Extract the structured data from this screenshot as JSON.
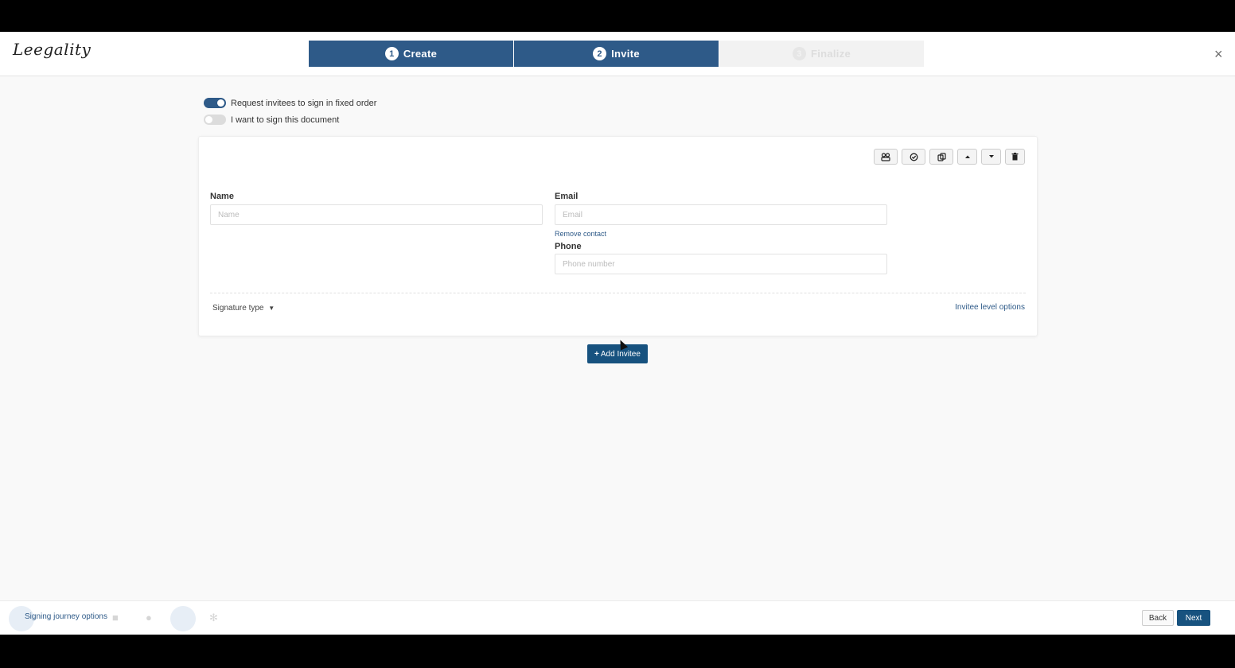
{
  "app": {
    "logo_text": "Leegality",
    "close_icon": "×"
  },
  "steps": [
    {
      "num": "1",
      "label": "Create",
      "state": "active"
    },
    {
      "num": "2",
      "label": "Invite",
      "state": "active"
    },
    {
      "num": "3",
      "label": "Finalize",
      "state": "inactive"
    }
  ],
  "toggles": {
    "fixed_order": {
      "label": "Request invitees to sign in fixed order",
      "on": true
    },
    "self_sign": {
      "label": "I want to sign this document",
      "on": false
    }
  },
  "invitee": {
    "name_label": "Name",
    "name_placeholder": "Name",
    "email_label": "Email",
    "email_placeholder": "Email",
    "remove_contact": "Remove contact",
    "phone_label": "Phone",
    "phone_placeholder": "Phone number",
    "signature_type": "Signature type",
    "invitee_level_options": "Invitee level options"
  },
  "actions": {
    "add_invitee": "Add Invitee"
  },
  "footer": {
    "signing_journey_options": "Signing journey options",
    "back": "Back",
    "next": "Next"
  },
  "colors": {
    "primary": "#2e5a88",
    "button": "#17527f"
  }
}
